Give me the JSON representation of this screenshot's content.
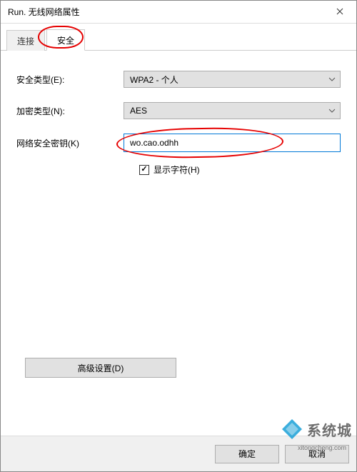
{
  "window": {
    "title": "Run. 无线网络属性"
  },
  "tabs": {
    "connection": "连接",
    "security": "安全"
  },
  "labels": {
    "securityType": "安全类型(E):",
    "encryptionType": "加密类型(N):",
    "networkKey": "网络安全密钥(K)",
    "showChars": "显示字符(H)",
    "advanced": "高级设置(D)",
    "ok": "确定",
    "cancel": "取消"
  },
  "values": {
    "securityType": "WPA2 - 个人",
    "encryptionType": "AES",
    "networkKey": "wo.cao.odhh",
    "showCharsChecked": true
  },
  "watermark": {
    "brand": "系统城",
    "url": "xitongcheng.com"
  }
}
